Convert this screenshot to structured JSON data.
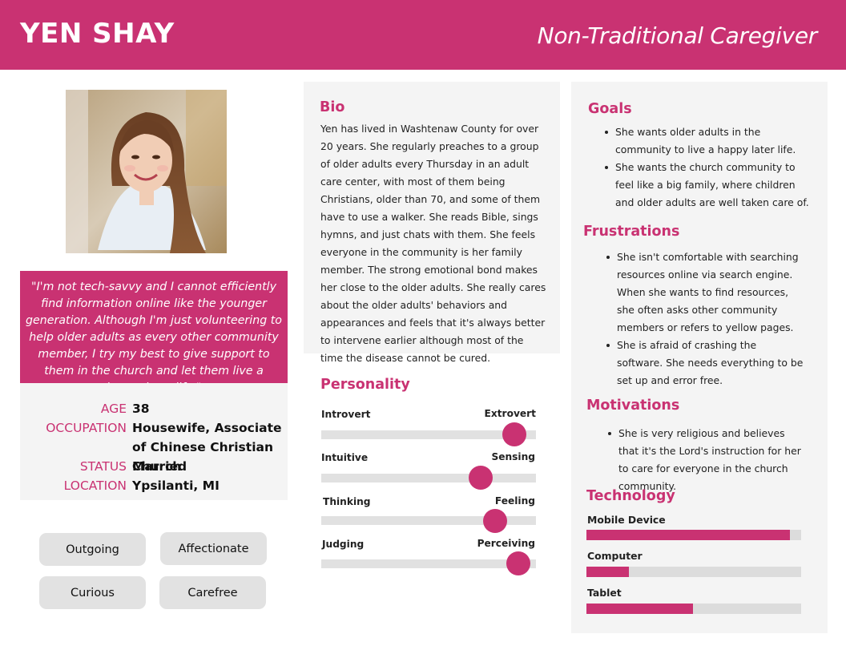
{
  "header": {
    "name": "YEN SHAY",
    "role": "Non-Traditional Caregiver"
  },
  "quote": "\"I'm not tech-savvy and I cannot efficiently find information online like the younger generation. Although I'm just volunteering to help older adults as every other community member, I try my best to give support to them in the church and let them live a happy later life.\"",
  "info": {
    "age_label": "AGE",
    "age": "38",
    "occupation_label": "OCCUPATION",
    "occupation": "Housewife, Associate of Chinese Christian Church",
    "status_label": "STATUS",
    "status": "Married",
    "location_label": "LOCATION",
    "location": "Ypsilanti, MI"
  },
  "traits": [
    "Outgoing",
    "Affectionate",
    "Curious",
    "Carefree"
  ],
  "bio": {
    "title": "Bio",
    "text": "Yen has lived in Washtenaw County for over 20 years. She regularly preaches to a group of older adults every Thursday in an adult care center, with most of them being Christians, older than 70, and some of them have to use a walker. She reads Bible, sings hymns, and just chats with them. She feels everyone in the community is her family member. The strong emotional bond makes her close to the older adults. She really cares about the older adults' behaviors and appearances and feels that it's always better to intervene earlier although most of the time the disease cannot be cured."
  },
  "personality": {
    "title": "Personality",
    "scales": [
      {
        "left": "Introvert",
        "right": "Extrovert",
        "value": 0.9
      },
      {
        "left": "Intuitive",
        "right": "Sensing",
        "value": 0.74
      },
      {
        "left": "Thinking",
        "right": "Feeling",
        "value": 0.81
      },
      {
        "left": "Judging",
        "right": "Perceiving",
        "value": 0.92
      }
    ]
  },
  "goals": {
    "title": "Goals",
    "items": [
      "She wants older adults in the community to live a happy later life.",
      "She wants the church community to feel like a big family, where children and older adults are well taken care of."
    ]
  },
  "frustrations": {
    "title": "Frustrations",
    "items": [
      "She isn't comfortable with searching resources online via search engine. When she wants to find resources, she often asks other community members or refers to yellow pages.",
      "She is afraid of crashing the software. She needs everything to be set up and error free."
    ]
  },
  "motivations": {
    "title": "Motivations",
    "items": [
      "She is very religious and believes that it's the Lord's instruction for her to care for everyone in the church community."
    ]
  },
  "technology": {
    "title": "Technology",
    "items": [
      {
        "label": "Mobile Device",
        "value": 0.95
      },
      {
        "label": "Computer",
        "value": 0.2
      },
      {
        "label": "Tablet",
        "value": 0.5
      }
    ]
  },
  "colors": {
    "accent": "#c93272",
    "panel": "#f4f4f4",
    "track": "#e1e1e1",
    "chip": "#e2e2e2"
  }
}
